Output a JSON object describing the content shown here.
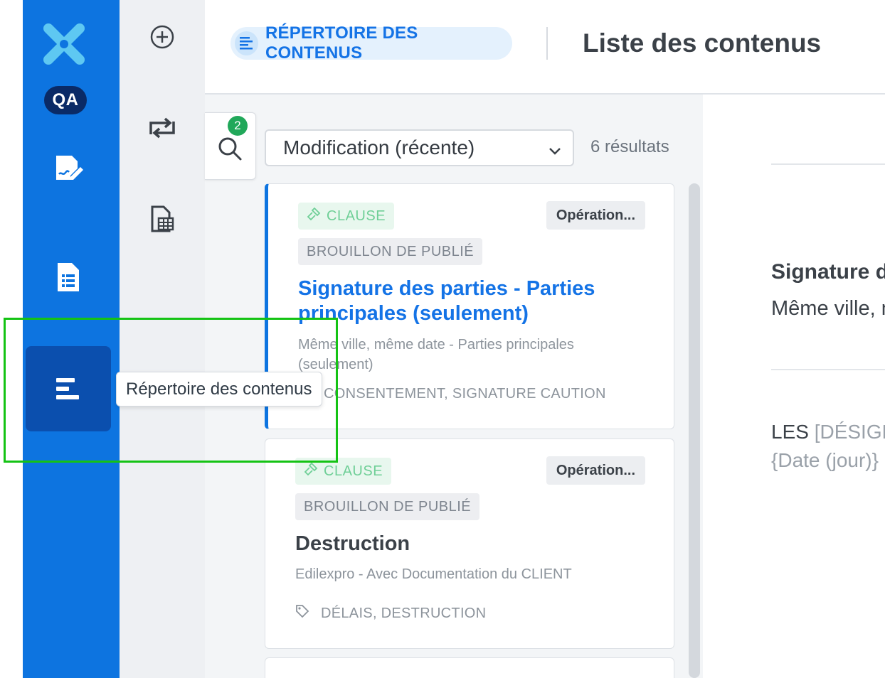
{
  "sidebar": {
    "environment_badge": "QA",
    "active_item": "content-directory",
    "tooltip": "Répertoire des contenus"
  },
  "header": {
    "breadcrumb": "RÉPERTOIRE DES CONTENUS",
    "title": "Liste des contenus"
  },
  "search": {
    "active_filters_count": "2"
  },
  "toolbar": {
    "sort_selected": "Modification (récente)",
    "result_count": "6 résultats"
  },
  "cards": [
    {
      "type": "CLAUSE",
      "category": "Opération...",
      "status": "BROUILLON DE PUBLIÉ",
      "title": "Signature des parties - Parties principales (seulement)",
      "description": "Même ville, même date - Parties principales (seulement)",
      "keywords": "CONSENTEMENT, SIGNATURE CAUTION",
      "selected": true
    },
    {
      "type": "CLAUSE",
      "category": "Opération...",
      "status": "BROUILLON DE PUBLIÉ",
      "title": "Destruction",
      "description": "Edilexpro - Avec Documentation du CLIENT",
      "keywords": "DÉLAIS, DESTRUCTION",
      "selected": false
    }
  ],
  "detail": {
    "title": "Signature des parties - Parties principales (seulement)",
    "subtitle": "Même ville, même date - Parties principales (seulement)",
    "body_line1_prefix": "LES ",
    "body_line1_placeholder": "[DÉSIGNATION DES PARTIES]",
    "body_line2": "{Date (jour)}"
  },
  "colors": {
    "primary_rail": "#0d74e0",
    "active_rail_item": "#0b4fae",
    "accent_link": "#1473e6",
    "badge_green": "#21a85a",
    "highlight_green": "#14c314"
  }
}
